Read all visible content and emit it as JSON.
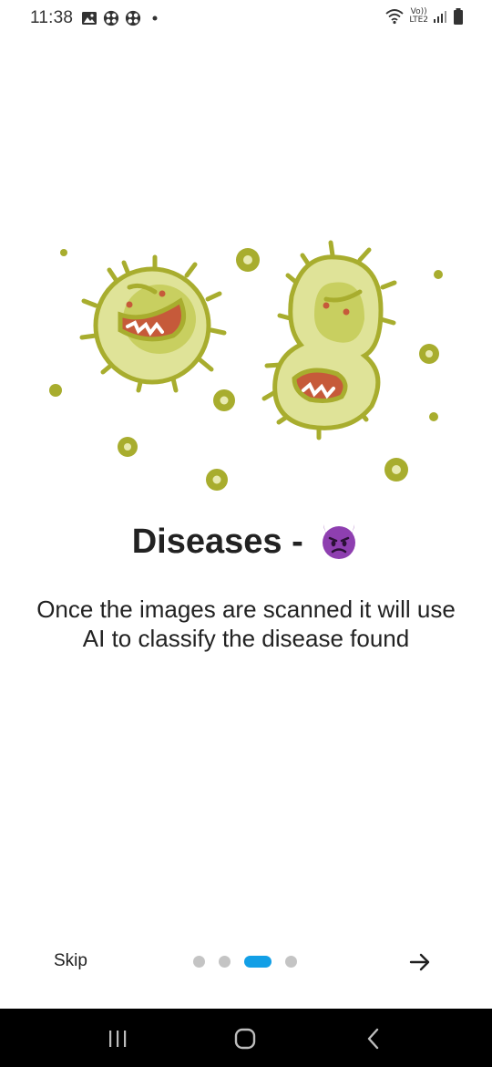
{
  "status_bar": {
    "time": "11:38",
    "left_icons": [
      "image-icon",
      "app-icon",
      "app-icon",
      "dot-icon"
    ],
    "right_icons": [
      "wifi-icon",
      "volte-lte2-icon",
      "signal-icon",
      "battery-icon"
    ],
    "lte_top": "Vo))",
    "lte_bottom": "LTE2"
  },
  "onboarding": {
    "title": "Diseases -",
    "title_emoji": "smiling-devil-emoji",
    "description": "Once the images are scanned it will use AI to classify the disease found"
  },
  "pager": {
    "skip_label": "Skip",
    "page_count": 4,
    "active_index": 2,
    "active_color": "#129fe6",
    "inactive_color": "#c4c4c4"
  },
  "colors": {
    "germ_body": "#a8ad2e",
    "germ_fill": "#dfe398",
    "germ_inner": "#c8cf60",
    "emoji_purple": "#8e3fb0"
  },
  "system_nav": {
    "buttons": [
      "recents-icon",
      "home-icon",
      "back-icon"
    ]
  }
}
